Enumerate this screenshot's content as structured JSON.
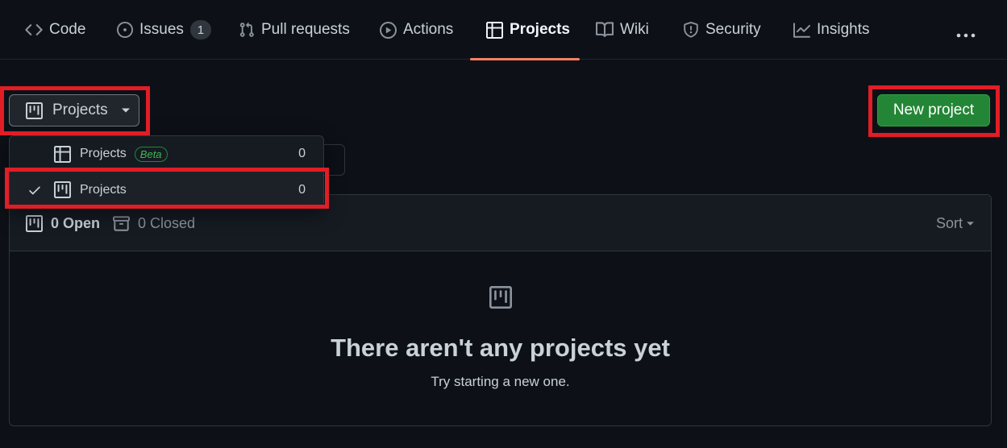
{
  "nav": {
    "tabs": [
      {
        "label": "Code",
        "icon": "code-icon"
      },
      {
        "label": "Issues",
        "icon": "issue-opened-icon",
        "count": "1"
      },
      {
        "label": "Pull requests",
        "icon": "git-pull-request-icon"
      },
      {
        "label": "Actions",
        "icon": "play-icon"
      },
      {
        "label": "Projects",
        "icon": "table-icon",
        "active": true
      },
      {
        "label": "Wiki",
        "icon": "book-icon"
      },
      {
        "label": "Security",
        "icon": "shield-icon"
      },
      {
        "label": "Insights",
        "icon": "graph-icon"
      }
    ],
    "more_icon": "kebab-horizontal-icon",
    "active_underline_color": "#f78166"
  },
  "toolbar": {
    "projects_button_label": "Projects",
    "projects_button_icon": "project-icon",
    "new_project_label": "New project",
    "new_project_color": "#238636"
  },
  "dropdown": {
    "items": [
      {
        "label": "Projects",
        "badge": "Beta",
        "count": "0",
        "icon": "table-icon",
        "selected": false
      },
      {
        "label": "Projects",
        "count": "0",
        "icon": "project-icon",
        "selected": true
      }
    ]
  },
  "list": {
    "open_label": "0 Open",
    "closed_label": "0 Closed",
    "sort_label": "Sort",
    "empty_title": "There aren't any projects yet",
    "empty_subtitle": "Try starting a new one."
  },
  "highlight_color": "#e11d26"
}
